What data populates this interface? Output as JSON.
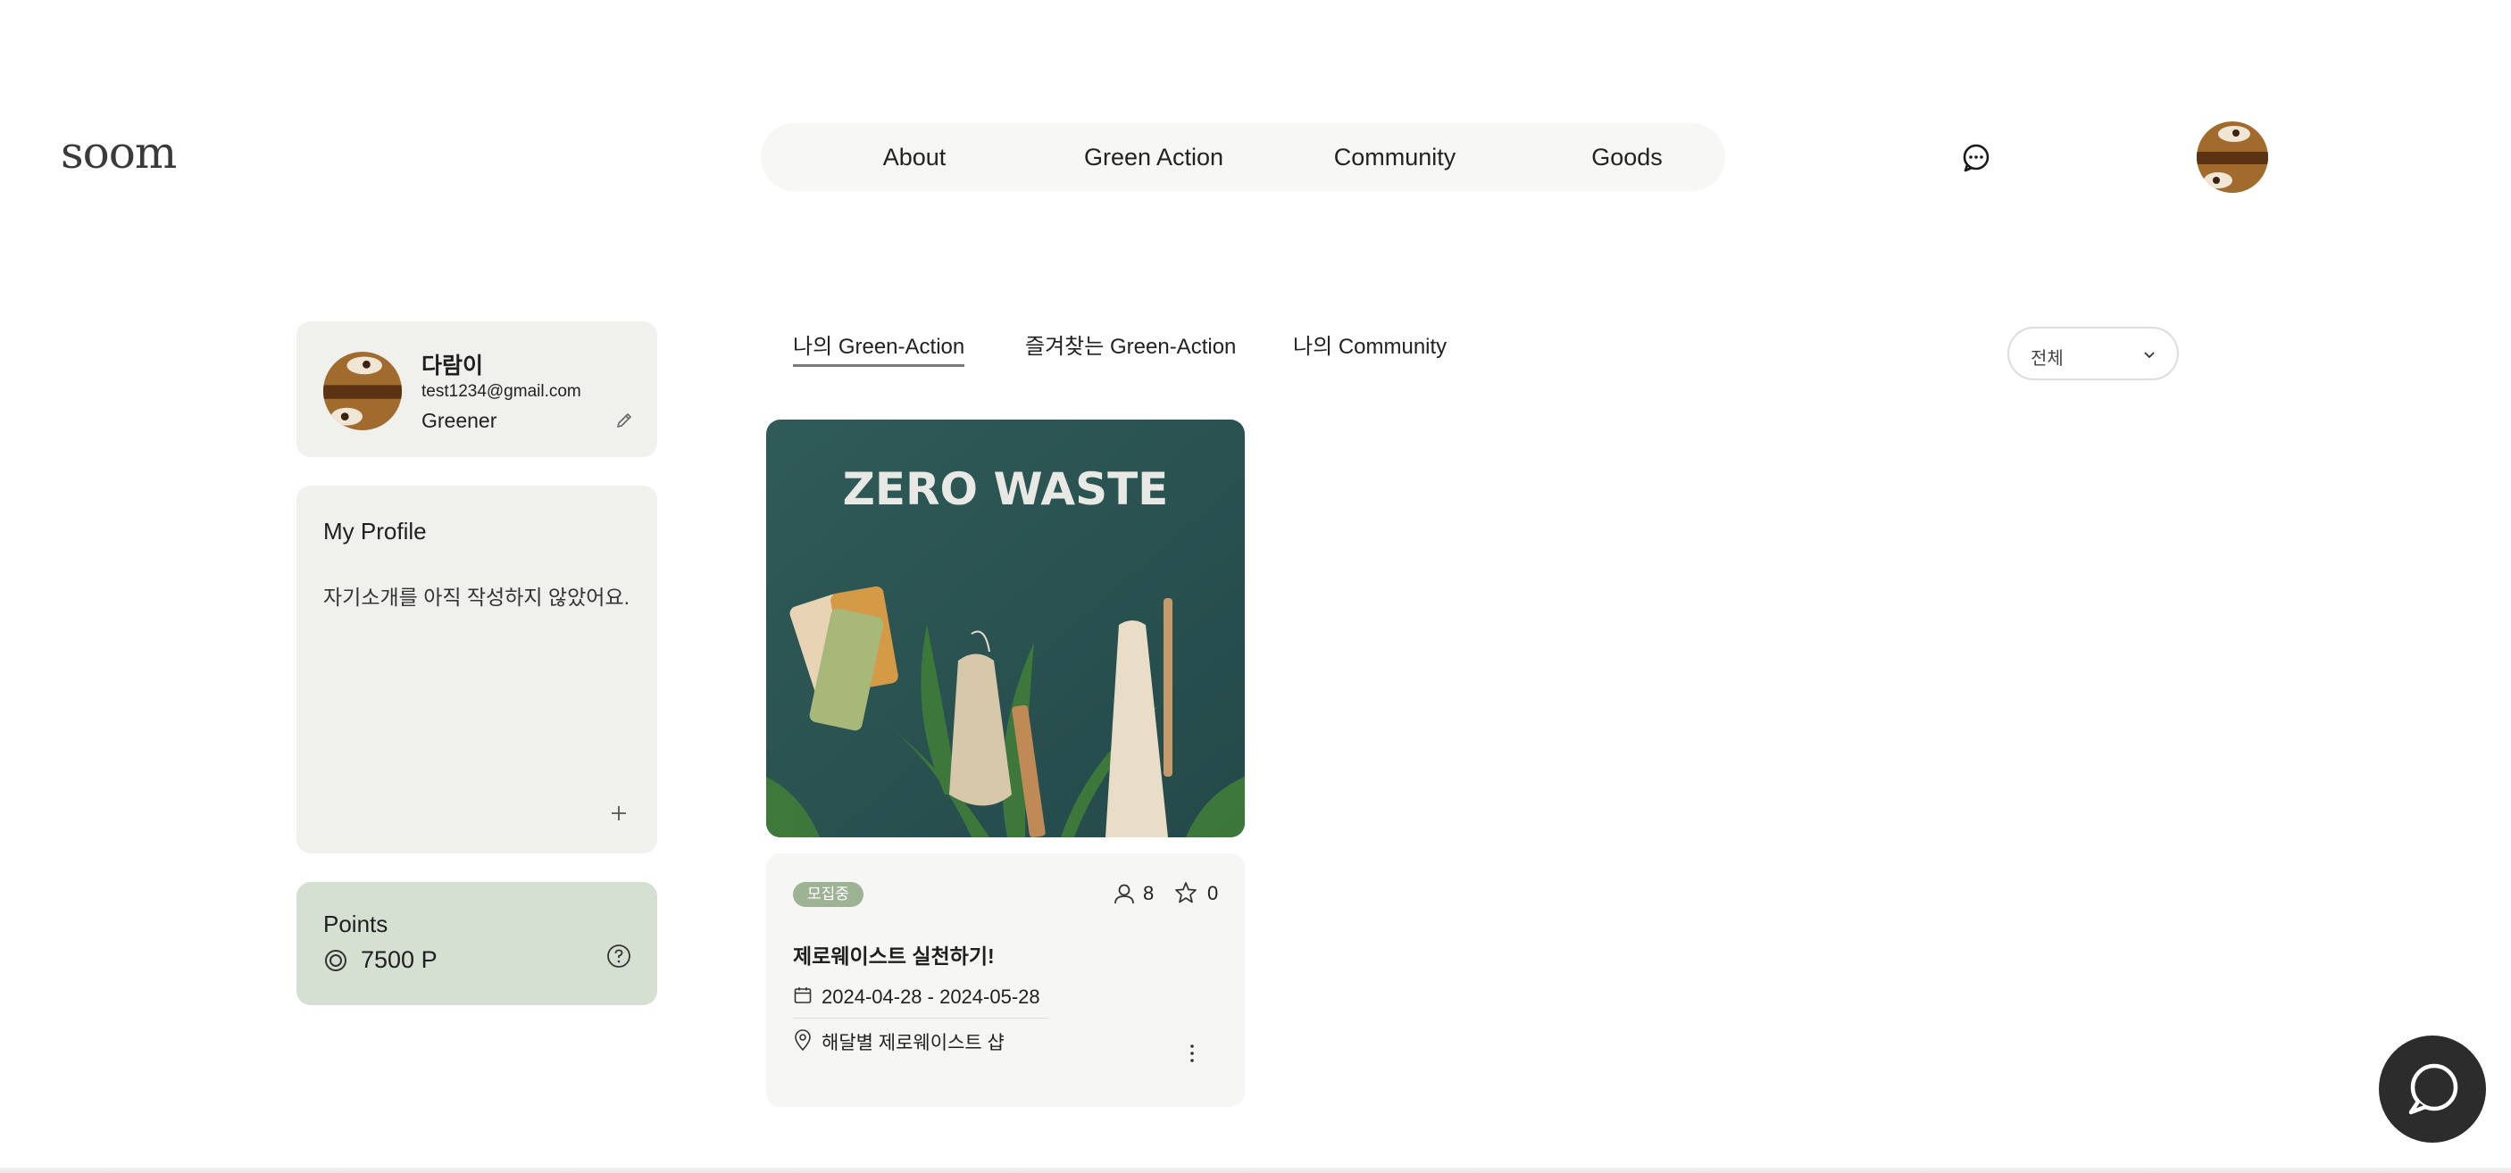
{
  "header": {
    "logo": "soom",
    "nav": [
      {
        "label": "About"
      },
      {
        "label": "Green Action"
      },
      {
        "label": "Community"
      },
      {
        "label": "Goods"
      }
    ],
    "chat_icon": "chat-bubble-icon",
    "avatar_icon": "profile-avatar"
  },
  "user": {
    "name": "다람이",
    "email": "test1234@gmail.com",
    "grade": "Greener",
    "edit_icon": "pencil-icon"
  },
  "profile": {
    "title": "My Profile",
    "intro": "자기소개를 아직 작성하지 않았어요.",
    "add_icon": "plus-icon"
  },
  "points": {
    "title": "Points",
    "value": "7500 P",
    "coin_icon": "coin-icon",
    "help_icon": "question-circle-icon"
  },
  "tabs": [
    {
      "label": "나의 Green-Action",
      "active": true
    },
    {
      "label": "즐겨찾는 Green-Action",
      "active": false
    },
    {
      "label": "나의 Community",
      "active": false
    }
  ],
  "filter": {
    "selected": "전체"
  },
  "actions": [
    {
      "image_text": "ZERO WASTE",
      "badge": "모집중",
      "participants": "8",
      "stars": "0",
      "title": "제로웨이스트 실천하기!",
      "date": "2024-04-28 - 2024-05-28",
      "place": "해달별 제로웨이스트 샵"
    }
  ],
  "colors": {
    "card_bg": "#f0f1ed",
    "points_bg": "#d6e0d2",
    "badge_bg": "#9eb393",
    "fab_bg": "#2c2c2c",
    "image_bg": "#2f5b58"
  }
}
